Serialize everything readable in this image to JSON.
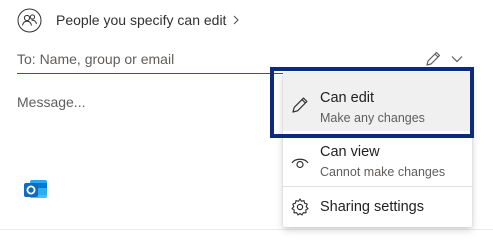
{
  "share": {
    "link_setting": "People you specify can edit",
    "to_placeholder": "To: Name, group or email",
    "message_placeholder": "Message..."
  },
  "icons": {
    "people": "people-icon",
    "chevron_right": "chevron-right-icon",
    "pencil": "pencil-icon",
    "chevron_down": "chevron-down-icon",
    "outlook": "outlook-icon",
    "eye": "eye-icon",
    "gear": "gear-icon"
  },
  "permission_menu": {
    "items": [
      {
        "title": "Can edit",
        "subtitle": "Make any changes",
        "selected": true
      },
      {
        "title": "Can view",
        "subtitle": "Cannot make changes",
        "selected": false
      },
      {
        "title": "Sharing settings"
      }
    ]
  },
  "colors": {
    "accent_underline": "#2b579a",
    "highlight_border": "#0c2b7a",
    "selected_bg": "#f0f0f0",
    "outlook_blue": "#0f6cbd"
  }
}
